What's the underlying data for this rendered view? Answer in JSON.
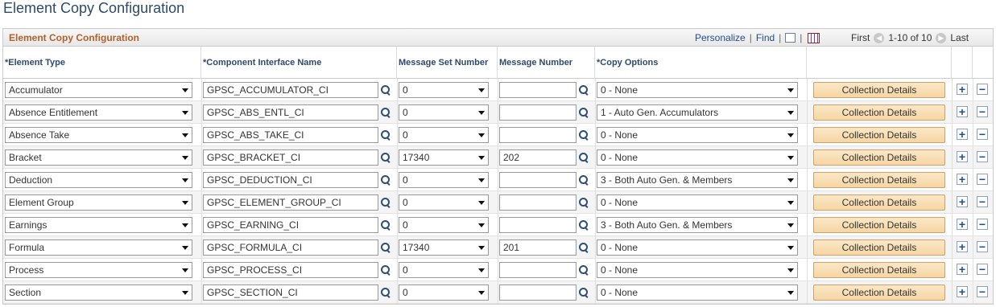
{
  "page": {
    "title": "Element Copy Configuration"
  },
  "grid": {
    "title": "Element Copy Configuration",
    "personalize": "Personalize",
    "find": "Find",
    "first": "First",
    "range": "1-10 of 10",
    "last": "Last"
  },
  "columns": {
    "element_type": "*Element Type",
    "ci_name": "*Component Interface Name",
    "msg_set": "Message Set Number",
    "msg_num": "Message Number",
    "copy_opts": "*Copy Options"
  },
  "button_label": "Collection Details",
  "icons": {
    "lookup": "magnifier-icon",
    "add": "plus-icon",
    "delete": "minus-icon"
  },
  "rows": [
    {
      "element_type": "Accumulator",
      "ci": "GPSC_ACCUMULATOR_CI",
      "msg_set": "0",
      "msg_num": "",
      "copy": "0 - None"
    },
    {
      "element_type": "Absence Entitlement",
      "ci": "GPSC_ABS_ENTL_CI",
      "msg_set": "0",
      "msg_num": "",
      "copy": "1 - Auto Gen. Accumulators"
    },
    {
      "element_type": "Absence Take",
      "ci": "GPSC_ABS_TAKE_CI",
      "msg_set": "0",
      "msg_num": "",
      "copy": "0 - None"
    },
    {
      "element_type": "Bracket",
      "ci": "GPSC_BRACKET_CI",
      "msg_set": "17340",
      "msg_num": "202",
      "copy": "0 - None"
    },
    {
      "element_type": "Deduction",
      "ci": "GPSC_DEDUCTION_CI",
      "msg_set": "0",
      "msg_num": "",
      "copy": "3 - Both Auto Gen. & Members"
    },
    {
      "element_type": "Element Group",
      "ci": "GPSC_ELEMENT_GROUP_CI",
      "msg_set": "0",
      "msg_num": "",
      "copy": "0 - None"
    },
    {
      "element_type": "Earnings",
      "ci": "GPSC_EARNING_CI",
      "msg_set": "0",
      "msg_num": "",
      "copy": "3 - Both Auto Gen. & Members"
    },
    {
      "element_type": "Formula",
      "ci": "GPSC_FORMULA_CI",
      "msg_set": "17340",
      "msg_num": "201",
      "copy": "0 - None"
    },
    {
      "element_type": "Process",
      "ci": "GPSC_PROCESS_CI",
      "msg_set": "0",
      "msg_num": "",
      "copy": "0 - None"
    },
    {
      "element_type": "Section",
      "ci": "GPSC_SECTION_CI",
      "msg_set": "0",
      "msg_num": "",
      "copy": "0 - None"
    }
  ]
}
